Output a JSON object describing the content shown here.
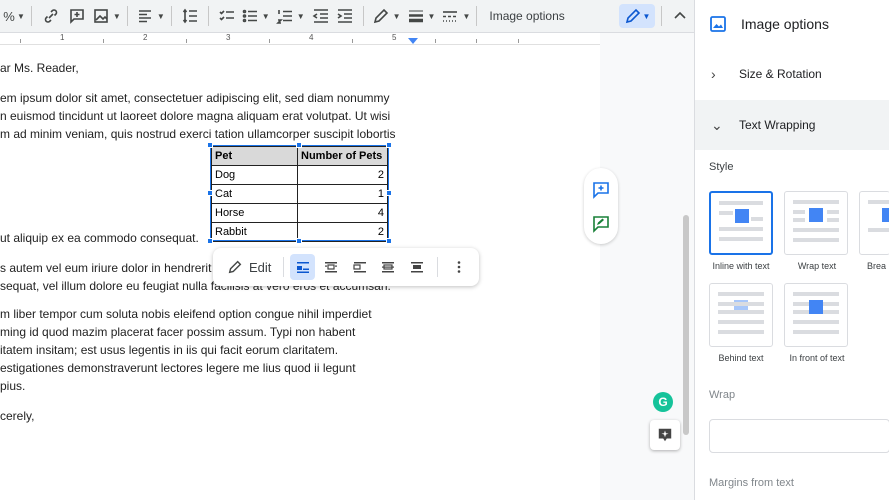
{
  "toolbar": {
    "zoom_suffix": "%",
    "image_options_label": "Image options"
  },
  "ruler": {
    "numbers": [
      "1",
      "2",
      "3",
      "4",
      "5"
    ]
  },
  "doc": {
    "greeting": "ar Ms. Reader,",
    "p1": [
      "em ipsum dolor sit amet, consectetuer adipiscing elit, sed diam nonummy",
      "n euismod tincidunt ut laoreet dolore magna aliquam erat volutpat. Ut wisi",
      "m ad minim veniam, quis nostrud exerci tation ullamcorper suscipit lobortis"
    ],
    "p1_tail": "ut aliquip ex ea commodo consequat.",
    "p2": [
      "s autem vel eum iriure dolor in hendrerit",
      "sequat, vel illum dolore eu feugiat nulla facilisis at vero eros et accumsan."
    ],
    "p3": [
      "m liber tempor cum soluta nobis eleifend option congue nihil imperdiet",
      "ming id quod mazim placerat facer possim assum. Typi non habent",
      "itatem insitam; est usus legentis in iis qui facit eorum claritatem.",
      "estigationes demonstraverunt lectores legere me lius quod ii legunt",
      "pius."
    ],
    "closing": "cerely,"
  },
  "table": {
    "headers": [
      "Pet",
      "Number of Pets"
    ],
    "rows": [
      [
        "Dog",
        "2"
      ],
      [
        "Cat",
        "1"
      ],
      [
        "Horse",
        "4"
      ],
      [
        "Rabbit",
        "2"
      ]
    ]
  },
  "image_toolbar": {
    "edit_label": "Edit"
  },
  "panel": {
    "title": "Image options",
    "sections": {
      "size_rotation": "Size & Rotation",
      "text_wrapping": "Text Wrapping"
    },
    "style_label": "Style",
    "wrap_options": [
      "Inline with text",
      "Wrap text",
      "Brea",
      "Behind text",
      "In front of text"
    ],
    "wrap_label": "Wrap",
    "margins_label": "Margins from text"
  },
  "grammarly_letter": "G",
  "colors": {
    "accent": "#1a73e8",
    "selected_bg": "#d3e3fd",
    "green": "#188038"
  }
}
